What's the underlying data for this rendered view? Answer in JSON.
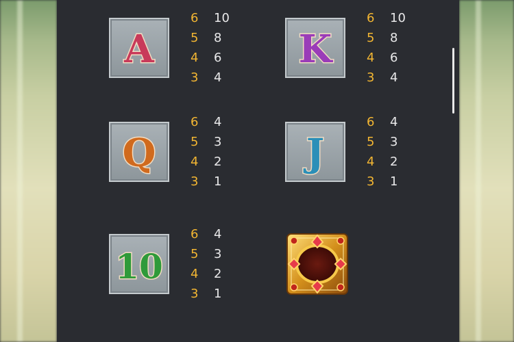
{
  "colors": {
    "background": "#2a2c31",
    "count_color": "#f3b632",
    "value_color": "#e9e9ea"
  },
  "symbols": [
    {
      "name": "A",
      "letter": "A",
      "icon": "letter-a-tile",
      "color": "#c83a5a",
      "paytable": [
        {
          "count": "6",
          "value": "10"
        },
        {
          "count": "5",
          "value": "8"
        },
        {
          "count": "4",
          "value": "6"
        },
        {
          "count": "3",
          "value": "4"
        }
      ]
    },
    {
      "name": "K",
      "letter": "K",
      "icon": "letter-k-tile",
      "color": "#9a3cb8",
      "paytable": [
        {
          "count": "6",
          "value": "10"
        },
        {
          "count": "5",
          "value": "8"
        },
        {
          "count": "4",
          "value": "6"
        },
        {
          "count": "3",
          "value": "4"
        }
      ]
    },
    {
      "name": "Q",
      "letter": "Q",
      "icon": "letter-q-tile",
      "color": "#d06a1e",
      "paytable": [
        {
          "count": "6",
          "value": "4"
        },
        {
          "count": "5",
          "value": "3"
        },
        {
          "count": "4",
          "value": "2"
        },
        {
          "count": "3",
          "value": "1"
        }
      ]
    },
    {
      "name": "J",
      "letter": "J",
      "icon": "letter-j-tile",
      "color": "#2b8fb8",
      "paytable": [
        {
          "count": "6",
          "value": "4"
        },
        {
          "count": "5",
          "value": "3"
        },
        {
          "count": "4",
          "value": "2"
        },
        {
          "count": "3",
          "value": "1"
        }
      ]
    },
    {
      "name": "10",
      "letter": "10",
      "icon": "number-10-tile",
      "color": "#2f9a3a",
      "paytable": [
        {
          "count": "6",
          "value": "4"
        },
        {
          "count": "5",
          "value": "3"
        },
        {
          "count": "4",
          "value": "2"
        },
        {
          "count": "3",
          "value": "1"
        }
      ]
    }
  ],
  "special_symbol": {
    "icon": "golden-jeweled-frame-icon"
  }
}
